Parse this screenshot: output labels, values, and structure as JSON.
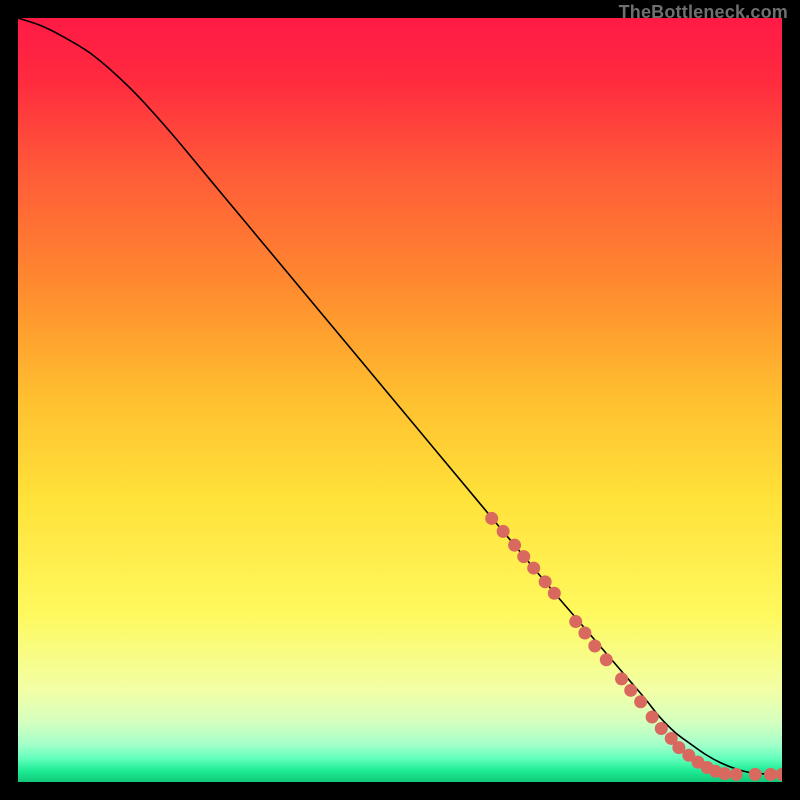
{
  "watermark": "TheBottleneck.com",
  "chart_data": {
    "type": "line",
    "title": "",
    "xlabel": "",
    "ylabel": "",
    "xlim": [
      0,
      100
    ],
    "ylim": [
      0,
      100
    ],
    "background": {
      "type": "vertical-gradient",
      "stops": [
        {
          "at": 0.0,
          "color": "#ff1a45"
        },
        {
          "at": 0.08,
          "color": "#ff2a3f"
        },
        {
          "at": 0.2,
          "color": "#ff5a38"
        },
        {
          "at": 0.35,
          "color": "#ff8a2f"
        },
        {
          "at": 0.5,
          "color": "#ffc02f"
        },
        {
          "at": 0.63,
          "color": "#ffe23a"
        },
        {
          "at": 0.78,
          "color": "#fff95e"
        },
        {
          "at": 0.88,
          "color": "#f2ffa6"
        },
        {
          "at": 0.92,
          "color": "#d6ffbe"
        },
        {
          "at": 0.95,
          "color": "#a6ffca"
        },
        {
          "at": 0.97,
          "color": "#5fffba"
        },
        {
          "at": 0.985,
          "color": "#1fec95"
        },
        {
          "at": 1.0,
          "color": "#10c878"
        }
      ]
    },
    "series": [
      {
        "name": "bottleneck-curve",
        "color": "#000000",
        "stroke_width": 1.6,
        "x": [
          0,
          3,
          6,
          10,
          15,
          20,
          25,
          30,
          35,
          40,
          45,
          50,
          55,
          60,
          65,
          70,
          73,
          76,
          79,
          82,
          84,
          86,
          88,
          90,
          92,
          94,
          96,
          98,
          100
        ],
        "y": [
          100,
          99,
          97.5,
          95,
          90.5,
          85,
          79,
          73,
          67,
          61,
          55,
          49,
          43,
          37,
          31,
          25,
          21.5,
          18,
          14.5,
          11,
          8.5,
          6.5,
          5,
          3.6,
          2.5,
          1.7,
          1.2,
          1.05,
          1
        ]
      }
    ],
    "highlight": {
      "name": "highlight-dots",
      "color": "#d9695f",
      "radius": 6.5,
      "points": [
        {
          "x": 62,
          "y": 34.5
        },
        {
          "x": 63.5,
          "y": 32.8
        },
        {
          "x": 65,
          "y": 31
        },
        {
          "x": 66.2,
          "y": 29.5
        },
        {
          "x": 67.5,
          "y": 28
        },
        {
          "x": 69,
          "y": 26.2
        },
        {
          "x": 70.2,
          "y": 24.7
        },
        {
          "x": 73,
          "y": 21
        },
        {
          "x": 74.2,
          "y": 19.5
        },
        {
          "x": 75.5,
          "y": 17.8
        },
        {
          "x": 77,
          "y": 16
        },
        {
          "x": 79,
          "y": 13.5
        },
        {
          "x": 80.2,
          "y": 12
        },
        {
          "x": 81.5,
          "y": 10.5
        },
        {
          "x": 83,
          "y": 8.5
        },
        {
          "x": 84.2,
          "y": 7
        },
        {
          "x": 85.5,
          "y": 5.7
        },
        {
          "x": 86.5,
          "y": 4.5
        },
        {
          "x": 87.8,
          "y": 3.5
        },
        {
          "x": 89,
          "y": 2.6
        },
        {
          "x": 90.2,
          "y": 1.9
        },
        {
          "x": 91.3,
          "y": 1.4
        },
        {
          "x": 92.5,
          "y": 1.1
        },
        {
          "x": 94,
          "y": 1
        },
        {
          "x": 96.5,
          "y": 1
        },
        {
          "x": 98.5,
          "y": 1
        },
        {
          "x": 100,
          "y": 1
        }
      ]
    }
  }
}
